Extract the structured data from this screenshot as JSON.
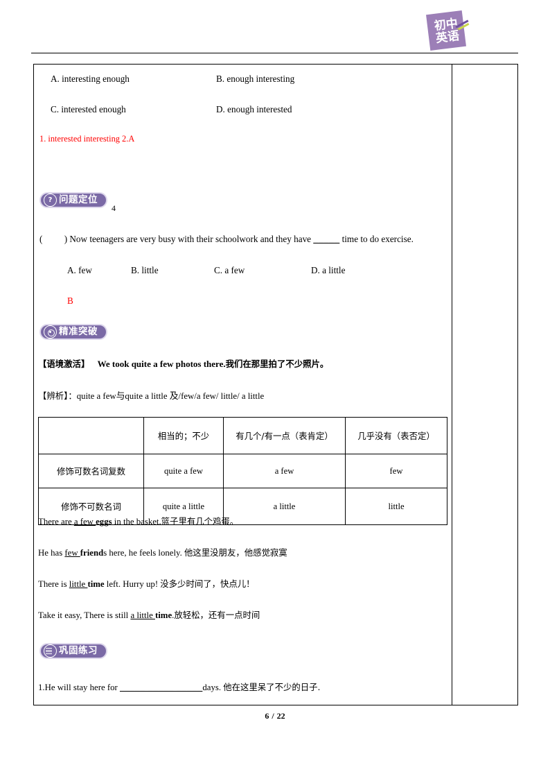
{
  "header": {
    "logo_line1": "初中",
    "logo_line2": "英语",
    "logo_color": "#9c7fb7",
    "accent_color": "#c9d64a"
  },
  "content": {
    "prev_question_options": [
      {
        "label": "A. interesting enough",
        "col": 1,
        "row": 1
      },
      {
        "label": "B. enough interesting",
        "col": 2,
        "row": 1
      },
      {
        "label": "C. interested enough",
        "col": 1,
        "row": 2
      },
      {
        "label": "D. enough interested",
        "col": 2,
        "row": 2
      }
    ],
    "prev_answer_line": "1. interested interesting    2.A",
    "prev_answer_color": "#ff0000",
    "badge_locate": {
      "icon": "question-mark-circle-icon",
      "label": "问题定位",
      "suffix": "4"
    },
    "question": {
      "bracket_open": "(",
      "bracket_close": ")",
      "stem_before": "Now teenagers are very busy with their schoolwork and they have",
      "blank": "_____",
      "stem_after": "time to do exercise.",
      "options": [
        "A. few",
        "B. little",
        "C. a few",
        "D. a little"
      ],
      "answer": "B",
      "answer_color": "#ff0000"
    },
    "badge_breakthrough": {
      "icon": "target-circle-icon",
      "label": "精准突破"
    },
    "context_line": {
      "tag": "【语境激活】",
      "english": "We took quite a few photos there.",
      "chinese": "我们在那里拍了不少照片。"
    },
    "analysis_line": {
      "tag": "【辨析】：",
      "body": "quite a few与quite a little  及/few/a few/ little/ a little"
    },
    "table": {
      "header": [
        "",
        "相当的；不少",
        "有几个/有一点（表肯定）",
        "几乎没有（表否定）"
      ],
      "rows": [
        {
          "label": "修饰可数名词复数",
          "cells": [
            "quite a few",
            "a few",
            "few"
          ]
        },
        {
          "label": "修饰不可数名词",
          "cells": [
            "quite a little",
            "a little",
            "little"
          ]
        }
      ]
    },
    "examples": [
      {
        "pre": "There are ",
        "underline": "a few ",
        "bold": "eggs",
        "post": " in the basket.",
        "chinese": "篮子里有几个鸡蛋。"
      },
      {
        "pre": "He has ",
        "underline": "few ",
        "bold": "friend",
        "post": "s here, he feels lonely. ",
        "chinese": "他这里没朋友，他感觉寂寞"
      },
      {
        "pre": "There is ",
        "underline": "little ",
        "bold": "time",
        "post": " left. Hurry up! ",
        "chinese": "没多少时间了，快点儿！"
      },
      {
        "pre": "Take it easy, There is still ",
        "underline": "a little ",
        "bold": "time",
        "post": ".",
        "chinese": "放轻松，还有一点时间"
      }
    ],
    "badge_practice": {
      "icon": "layers-stack-icon",
      "label": "巩固练习"
    },
    "practice": {
      "number": "1.",
      "text_before": "He will stay here for ",
      "blanks": "_____  _____  _____",
      "text_after": "days.  ",
      "chinese": "他在这里呆了不少的日子."
    }
  },
  "footer": {
    "current_page": "6",
    "separator": "/",
    "total_pages": "22"
  }
}
